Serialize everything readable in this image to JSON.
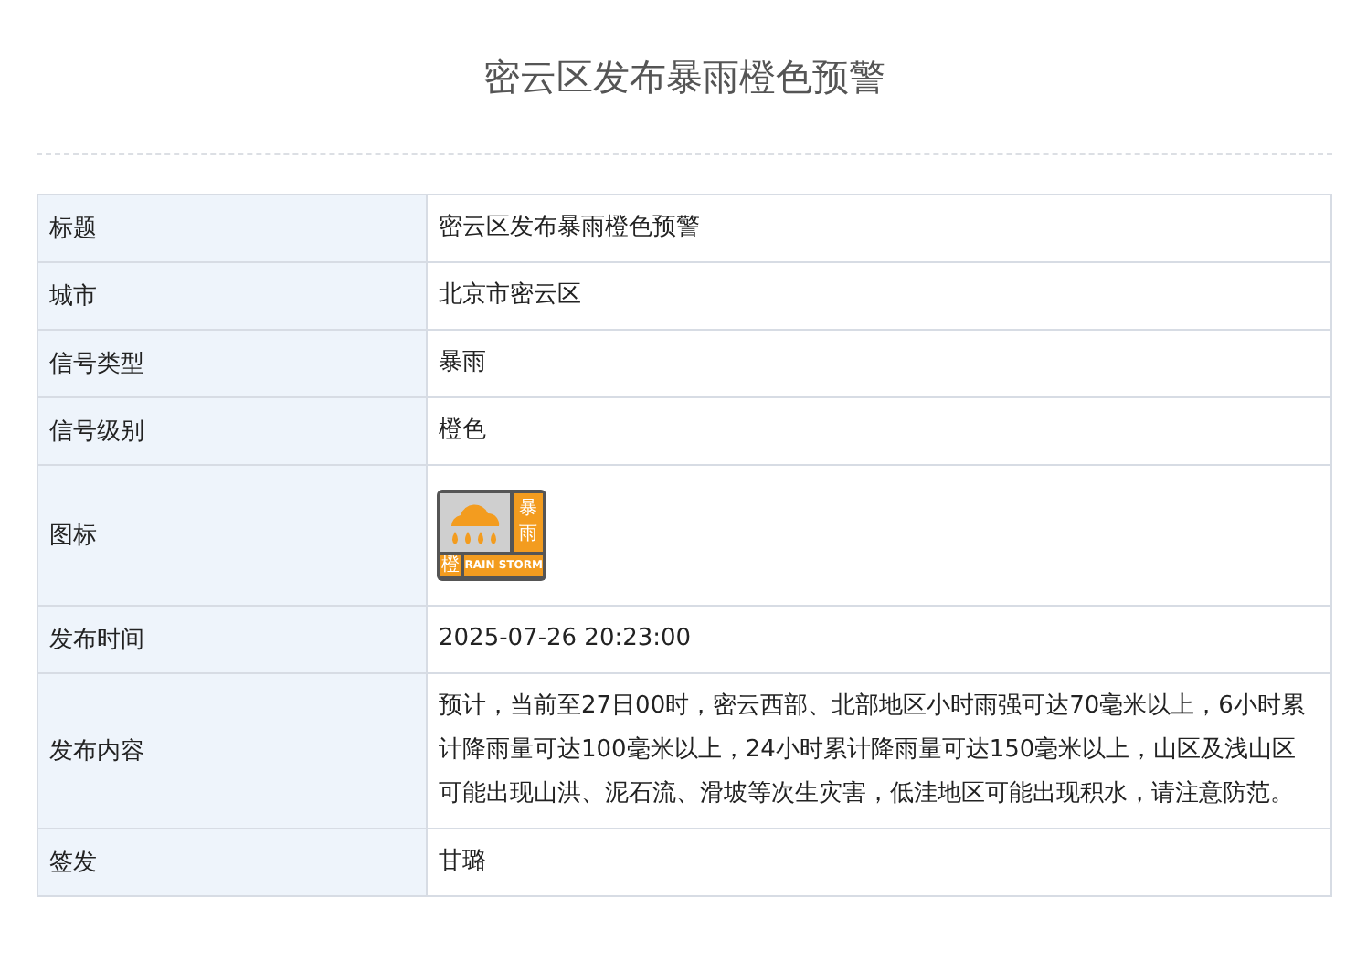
{
  "page_title": "密云区发布暴雨橙色预警",
  "rows": [
    {
      "kind": "text",
      "label": "标题",
      "value": "密云区发布暴雨橙色预警"
    },
    {
      "kind": "text",
      "label": "城市",
      "value": "北京市密云区"
    },
    {
      "kind": "text",
      "label": "信号类型",
      "value": "暴雨"
    },
    {
      "kind": "text",
      "label": "信号级别",
      "value": "橙色"
    },
    {
      "kind": "icon",
      "label": "图标",
      "icon": {
        "color": "#f39c1f",
        "type_chars": "暴雨",
        "level_char": "橙",
        "caption": "RAIN STORM"
      }
    },
    {
      "kind": "text",
      "label": "发布时间",
      "value": "2025-07-26 20:23:00"
    },
    {
      "kind": "text",
      "label": "发布内容",
      "value": "预计，当前至27日00时，密云西部、北部地区小时雨强可达70毫米以上，6小时累计降雨量可达100毫米以上，24小时累计降雨量可达150毫米以上，山区及浅山区可能出现山洪、泥石流、滑坡等次生灾害，低洼地区可能出现积水，请注意防范。"
    },
    {
      "kind": "text",
      "label": "签发",
      "value": "甘璐"
    }
  ]
}
